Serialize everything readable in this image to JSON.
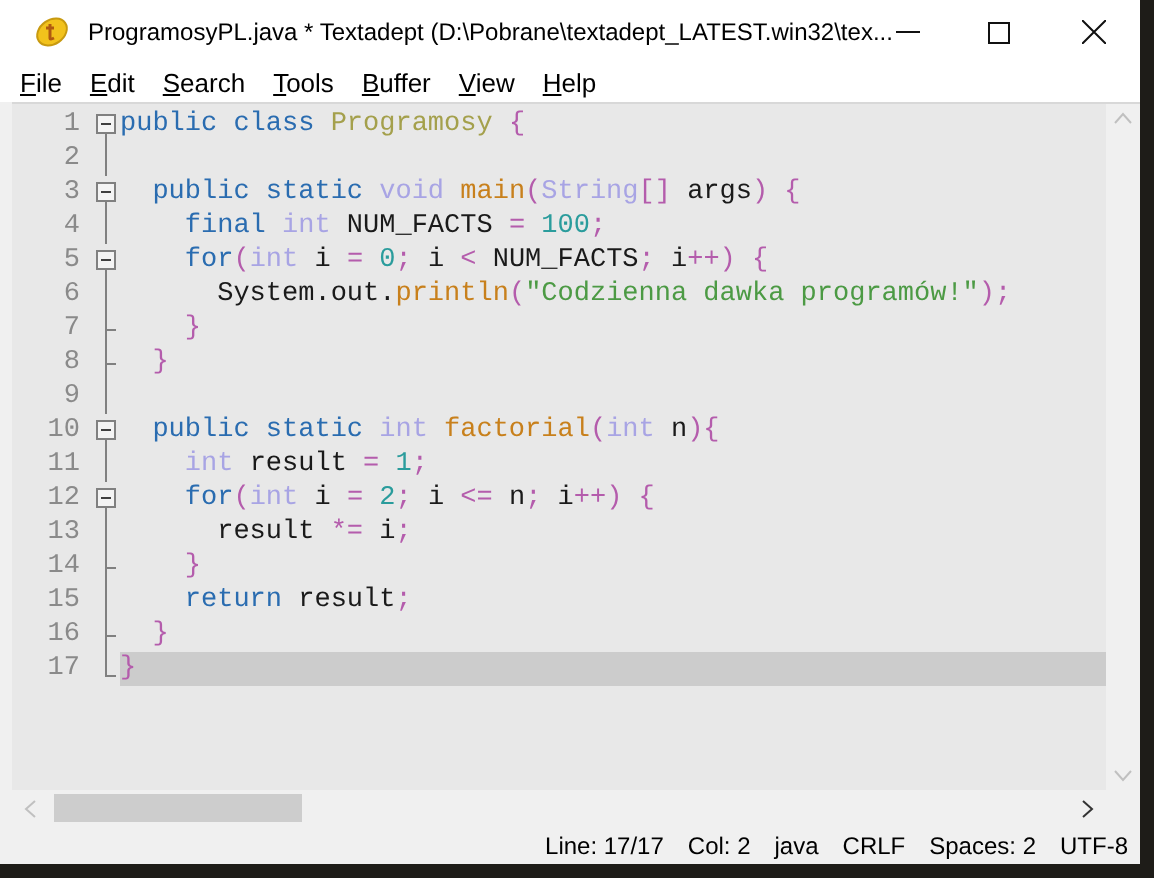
{
  "window": {
    "title": "ProgramosyPL.java * Textadept (D:\\Pobrane\\textadept_LATEST.win32\\tex..."
  },
  "menu": [
    {
      "label": "File"
    },
    {
      "label": "Edit"
    },
    {
      "label": "Search"
    },
    {
      "label": "Tools"
    },
    {
      "label": "Buffer"
    },
    {
      "label": "View"
    },
    {
      "label": "Help"
    }
  ],
  "editor": {
    "lines": [
      {
        "number": "1",
        "kind": "open",
        "selected": false,
        "tokens": [
          {
            "text": "public class ",
            "kind": "kw"
          },
          {
            "text": "Programosy",
            "kind": "cls"
          },
          {
            "text": " {",
            "kind": "op"
          }
        ]
      },
      {
        "number": "2",
        "kind": "line",
        "selected": false
      },
      {
        "number": "3",
        "kind": "open",
        "selected": false,
        "tokens": [
          {
            "text": "  public static ",
            "kind": "kw"
          },
          {
            "text": "void ",
            "kind": "type"
          },
          {
            "text": "main",
            "kind": "func"
          },
          {
            "text": "(",
            "kind": "op"
          },
          {
            "text": "String",
            "kind": "type"
          },
          {
            "text": "[] ",
            "kind": "op"
          },
          {
            "text": "args",
            "kind": "plain"
          },
          {
            "text": ") {",
            "kind": "op"
          }
        ]
      },
      {
        "number": "4",
        "kind": "line",
        "selected": false,
        "tokens": [
          {
            "text": "    final ",
            "kind": "kw"
          },
          {
            "text": "int ",
            "kind": "type"
          },
          {
            "text": "NUM_FACTS ",
            "kind": "plain"
          },
          {
            "text": "= ",
            "kind": "op"
          },
          {
            "text": "100",
            "kind": "num"
          },
          {
            "text": ";",
            "kind": "op"
          }
        ]
      },
      {
        "number": "5",
        "kind": "open",
        "selected": false,
        "tokens": [
          {
            "text": "    for",
            "kind": "kw"
          },
          {
            "text": "(",
            "kind": "op"
          },
          {
            "text": "int ",
            "kind": "type"
          },
          {
            "text": "i ",
            "kind": "plain"
          },
          {
            "text": "= ",
            "kind": "op"
          },
          {
            "text": "0",
            "kind": "num"
          },
          {
            "text": "; ",
            "kind": "op"
          },
          {
            "text": "i ",
            "kind": "plain"
          },
          {
            "text": "< ",
            "kind": "op"
          },
          {
            "text": "NUM_FACTS",
            "kind": "plain"
          },
          {
            "text": "; ",
            "kind": "op"
          },
          {
            "text": "i",
            "kind": "plain"
          },
          {
            "text": "++) {",
            "kind": "op"
          }
        ]
      },
      {
        "number": "6",
        "kind": "line",
        "selected": false,
        "tokens": [
          {
            "text": "      System.out.",
            "kind": "plain"
          },
          {
            "text": "println",
            "kind": "func"
          },
          {
            "text": "(",
            "kind": "op"
          },
          {
            "text": "\"Codzienna dawka programów!\"",
            "kind": "str"
          },
          {
            "text": ");",
            "kind": "op"
          }
        ]
      },
      {
        "number": "7",
        "kind": "tick",
        "selected": false,
        "tokens": [
          {
            "text": "    }",
            "kind": "op"
          }
        ]
      },
      {
        "number": "8",
        "kind": "tick",
        "selected": false,
        "tokens": [
          {
            "text": "  }",
            "kind": "op"
          }
        ]
      },
      {
        "number": "9",
        "kind": "line",
        "selected": false
      },
      {
        "number": "10",
        "kind": "open",
        "selected": false,
        "tokens": [
          {
            "text": "  public static ",
            "kind": "kw"
          },
          {
            "text": "int ",
            "kind": "type"
          },
          {
            "text": "factorial",
            "kind": "func"
          },
          {
            "text": "(",
            "kind": "op"
          },
          {
            "text": "int ",
            "kind": "type"
          },
          {
            "text": "n",
            "kind": "plain"
          },
          {
            "text": "){",
            "kind": "op"
          }
        ]
      },
      {
        "number": "11",
        "kind": "line",
        "selected": false,
        "tokens": [
          {
            "text": "    int ",
            "kind": "type"
          },
          {
            "text": "result ",
            "kind": "plain"
          },
          {
            "text": "= ",
            "kind": "op"
          },
          {
            "text": "1",
            "kind": "num"
          },
          {
            "text": ";",
            "kind": "op"
          }
        ]
      },
      {
        "number": "12",
        "kind": "open",
        "selected": false,
        "tokens": [
          {
            "text": "    for",
            "kind": "kw"
          },
          {
            "text": "(",
            "kind": "op"
          },
          {
            "text": "int ",
            "kind": "type"
          },
          {
            "text": "i ",
            "kind": "plain"
          },
          {
            "text": "= ",
            "kind": "op"
          },
          {
            "text": "2",
            "kind": "num"
          },
          {
            "text": "; ",
            "kind": "op"
          },
          {
            "text": "i ",
            "kind": "plain"
          },
          {
            "text": "<= ",
            "kind": "op"
          },
          {
            "text": "n",
            "kind": "plain"
          },
          {
            "text": "; ",
            "kind": "op"
          },
          {
            "text": "i",
            "kind": "plain"
          },
          {
            "text": "++) {",
            "kind": "op"
          }
        ]
      },
      {
        "number": "13",
        "kind": "line",
        "selected": false,
        "tokens": [
          {
            "text": "      result ",
            "kind": "plain"
          },
          {
            "text": "*= ",
            "kind": "op"
          },
          {
            "text": "i",
            "kind": "plain"
          },
          {
            "text": ";",
            "kind": "op"
          }
        ]
      },
      {
        "number": "14",
        "kind": "tick",
        "selected": false,
        "tokens": [
          {
            "text": "    }",
            "kind": "op"
          }
        ]
      },
      {
        "number": "15",
        "kind": "line",
        "selected": false,
        "tokens": [
          {
            "text": "    return ",
            "kind": "kw"
          },
          {
            "text": "result",
            "kind": "plain"
          },
          {
            "text": ";",
            "kind": "op"
          }
        ]
      },
      {
        "number": "16",
        "kind": "tick",
        "selected": false,
        "tokens": [
          {
            "text": "  }",
            "kind": "op"
          }
        ]
      },
      {
        "number": "17",
        "kind": "end",
        "selected": true,
        "tokens": [
          {
            "text": "}",
            "kind": "op"
          }
        ]
      }
    ]
  },
  "status_bar": [
    "Line: 17/17",
    "Col: 2",
    "java",
    "CRLF",
    "Spaces: 2",
    "UTF-8"
  ]
}
